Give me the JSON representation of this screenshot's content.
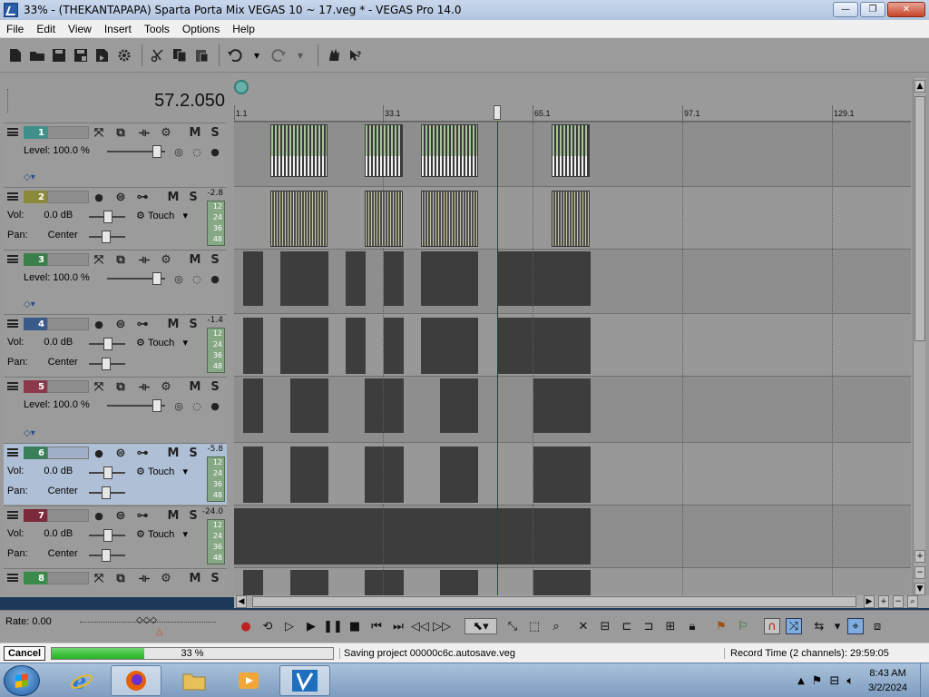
{
  "window": {
    "title": "33% - (THEKANTAPAPA) Sparta Porta Mix VEGAS 10 ~ 17.veg * - VEGAS Pro 14.0",
    "minimize": "—",
    "restore": "❐",
    "close": "✕"
  },
  "menu": [
    "File",
    "Edit",
    "View",
    "Insert",
    "Tools",
    "Options",
    "Help"
  ],
  "timecode": "57.2.050",
  "ruler": [
    "1.1",
    "33.1",
    "65.1",
    "97.1",
    "129.1"
  ],
  "tracks": [
    {
      "num": "1",
      "type": "video",
      "color": "#3f8f8a",
      "level_label": "Level:",
      "level": "100.0 %",
      "mute": "M",
      "solo": "S"
    },
    {
      "num": "2",
      "type": "audio",
      "color": "#8c8a3a",
      "vol_label": "Vol:",
      "vol": "0.0 dB",
      "pan_label": "Pan:",
      "pan": "Center",
      "mode": "Touch",
      "db": "-2.8",
      "meter": [
        "12",
        "24",
        "36",
        "48"
      ],
      "mute": "M",
      "solo": "S"
    },
    {
      "num": "3",
      "type": "video",
      "color": "#3a7f4a",
      "level_label": "Level:",
      "level": "100.0 %",
      "mute": "M",
      "solo": "S"
    },
    {
      "num": "4",
      "type": "audio",
      "color": "#3a5a8a",
      "vol_label": "Vol:",
      "vol": "0.0 dB",
      "pan_label": "Pan:",
      "pan": "Center",
      "mode": "Touch",
      "db": "-1.4",
      "meter": [
        "12",
        "24",
        "36",
        "48"
      ],
      "mute": "M",
      "solo": "S"
    },
    {
      "num": "5",
      "type": "video",
      "color": "#8a3a4a",
      "level_label": "Level:",
      "level": "100.0 %",
      "mute": "M",
      "solo": "S"
    },
    {
      "num": "6",
      "type": "audio",
      "color": "#3a7f5a",
      "vol_label": "Vol:",
      "vol": "0.0 dB",
      "pan_label": "Pan:",
      "pan": "Center",
      "mode": "Touch",
      "db": "-5.8",
      "meter": [
        "12",
        "24",
        "36",
        "48"
      ],
      "mute": "M",
      "solo": "S",
      "selected": true
    },
    {
      "num": "7",
      "type": "audio",
      "color": "#7a2a3a",
      "vol_label": "Vol:",
      "vol": "0.0 dB",
      "pan_label": "Pan:",
      "pan": "Center",
      "mode": "Touch",
      "db": "-24.0",
      "meter": [
        "12",
        "24",
        "36",
        "48"
      ],
      "mute": "M",
      "solo": "S"
    },
    {
      "num": "8",
      "type": "video",
      "color": "#3a8a4a",
      "mute": "M",
      "solo": "S"
    }
  ],
  "transport": {
    "rate": "Rate: 0.00"
  },
  "status": {
    "cancel": "Cancel",
    "progress_pct": "33 %",
    "progress_fraction": 0.33,
    "message": "Saving project 00000c6c.autosave.veg",
    "record_time": "Record Time (2 channels): 29:59:05"
  },
  "taskbar": {
    "time": "8:43 AM",
    "date": "3/2/2024"
  },
  "colors": {
    "cursor": "#1f2bb8",
    "progress": "#27b024"
  }
}
